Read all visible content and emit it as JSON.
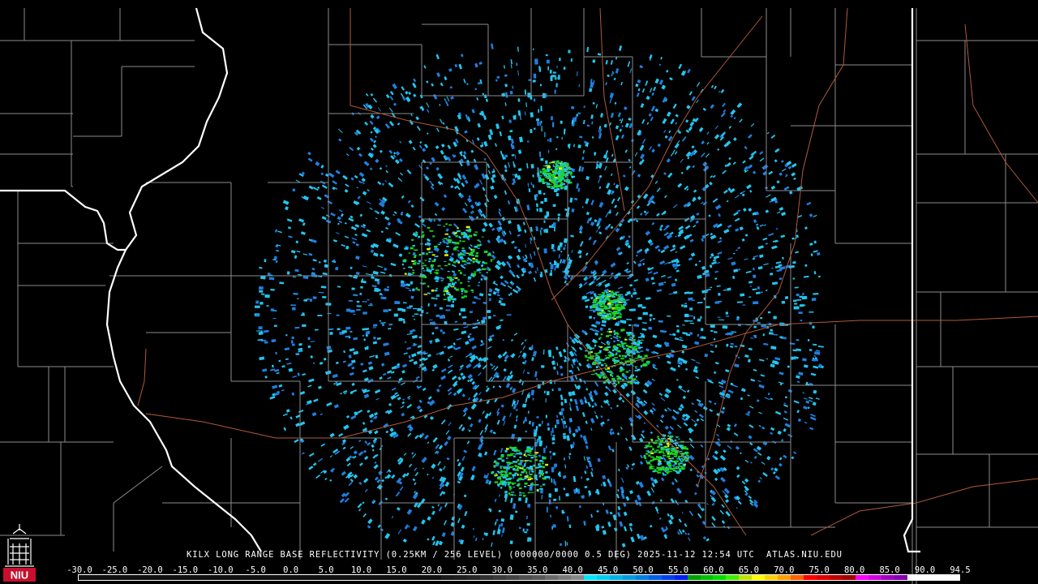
{
  "caption": {
    "station": "KILX",
    "product": "LONG RANGE BASE REFLECTIVITY",
    "resolution": "(0.25KM / 256 LEVEL)",
    "volume": "(000000/0000 0.5 DEG)",
    "datetime": "2025-11-12 12:54 UTC",
    "source": "ATLAS.NIU.EDU"
  },
  "legend": {
    "labels": [
      "-30.0",
      "-25.0",
      "-20.0",
      "-15.0",
      "-10.0",
      "-5.0",
      "0.0",
      "5.0",
      "10.0",
      "15.0",
      "20.0",
      "25.0",
      "30.0",
      "35.0",
      "40.0",
      "45.0",
      "50.0",
      "55.0",
      "60.0",
      "65.0",
      "70.0",
      "75.0",
      "80.0",
      "85.0",
      "90.0",
      "94.5"
    ],
    "colors": [
      "#101010",
      "#101010",
      "#101010",
      "#101010",
      "#101010",
      "#101010",
      "#101010",
      "#101010",
      "#101010",
      "#101010",
      "#101010",
      "#101010",
      "#101010",
      "#101010",
      "#101010",
      "#101010",
      "#101010",
      "#101010",
      "#101010",
      "#101010",
      "#101010",
      "#101010",
      "#101010",
      "#101010",
      "#101010",
      "#101010",
      "#101010",
      "#101010",
      "#1a1a1a",
      "#1e1e1e",
      "#262626",
      "#303030",
      "#3a3a3a",
      "#444444",
      "#4e4e4e",
      "#585858",
      "#6a6a6a",
      "#7a7a7a",
      "#888888",
      "#00e5ff",
      "#00d0f0",
      "#00b4e6",
      "#009cdc",
      "#0080e0",
      "#0060e6",
      "#0040ee",
      "#0020f4",
      "#00a000",
      "#00c000",
      "#00e000",
      "#40f000",
      "#c0e000",
      "#ffff00",
      "#ffd000",
      "#ffa000",
      "#ff6000",
      "#ff0000",
      "#e00000",
      "#c00000",
      "#a00000",
      "#ff00ff",
      "#d000e0",
      "#a000c0",
      "#8800b0",
      "#ffffff",
      "#ffffff",
      "#ffffff",
      "#ffffff"
    ]
  },
  "logo": {
    "text": "NIU"
  },
  "colors": {
    "background": "#000000",
    "county_lines": "#8c8c8c",
    "state_lines": "#ffffff",
    "highways": "#b05a3a",
    "echo_light": "#22c6f0",
    "echo_medium": "#1f7fe0",
    "echo_green": "#1cd41c",
    "echo_yellow": "#f0f000"
  }
}
